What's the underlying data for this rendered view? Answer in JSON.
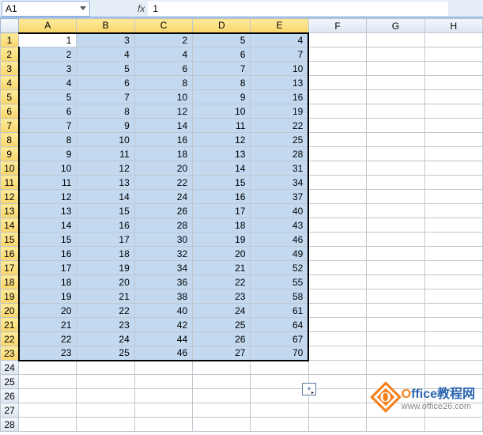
{
  "nameBox": "A1",
  "fxLabel": "fx",
  "formulaValue": "1",
  "colHeaders": [
    "A",
    "B",
    "C",
    "D",
    "E",
    "F",
    "G",
    "H"
  ],
  "selectedColCount": 5,
  "rowCount": 28,
  "selectedRowCount": 23,
  "autofillIcon": "+",
  "grid": [
    [
      1,
      3,
      2,
      5,
      4
    ],
    [
      2,
      4,
      4,
      6,
      7
    ],
    [
      3,
      5,
      6,
      7,
      10
    ],
    [
      4,
      6,
      8,
      8,
      13
    ],
    [
      5,
      7,
      10,
      9,
      16
    ],
    [
      6,
      8,
      12,
      10,
      19
    ],
    [
      7,
      9,
      14,
      11,
      22
    ],
    [
      8,
      10,
      16,
      12,
      25
    ],
    [
      9,
      11,
      18,
      13,
      28
    ],
    [
      10,
      12,
      20,
      14,
      31
    ],
    [
      11,
      13,
      22,
      15,
      34
    ],
    [
      12,
      14,
      24,
      16,
      37
    ],
    [
      13,
      15,
      26,
      17,
      40
    ],
    [
      14,
      16,
      28,
      18,
      43
    ],
    [
      15,
      17,
      30,
      19,
      46
    ],
    [
      16,
      18,
      32,
      20,
      49
    ],
    [
      17,
      19,
      34,
      21,
      52
    ],
    [
      18,
      20,
      36,
      22,
      55
    ],
    [
      19,
      21,
      38,
      23,
      58
    ],
    [
      20,
      22,
      40,
      24,
      61
    ],
    [
      21,
      23,
      42,
      25,
      64
    ],
    [
      22,
      24,
      44,
      26,
      67
    ],
    [
      23,
      25,
      46,
      27,
      70
    ]
  ],
  "chart_data": {
    "type": "table",
    "columns": [
      "A",
      "B",
      "C",
      "D",
      "E"
    ],
    "rows": [
      [
        1,
        3,
        2,
        5,
        4
      ],
      [
        2,
        4,
        4,
        6,
        7
      ],
      [
        3,
        5,
        6,
        7,
        10
      ],
      [
        4,
        6,
        8,
        8,
        13
      ],
      [
        5,
        7,
        10,
        9,
        16
      ],
      [
        6,
        8,
        12,
        10,
        19
      ],
      [
        7,
        9,
        14,
        11,
        22
      ],
      [
        8,
        10,
        16,
        12,
        25
      ],
      [
        9,
        11,
        18,
        13,
        28
      ],
      [
        10,
        12,
        20,
        14,
        31
      ],
      [
        11,
        13,
        22,
        15,
        34
      ],
      [
        12,
        14,
        24,
        16,
        37
      ],
      [
        13,
        15,
        26,
        17,
        40
      ],
      [
        14,
        16,
        28,
        18,
        43
      ],
      [
        15,
        17,
        30,
        19,
        46
      ],
      [
        16,
        18,
        32,
        20,
        49
      ],
      [
        17,
        19,
        34,
        21,
        52
      ],
      [
        18,
        20,
        36,
        22,
        55
      ],
      [
        19,
        21,
        38,
        23,
        58
      ],
      [
        20,
        22,
        40,
        24,
        61
      ],
      [
        21,
        23,
        42,
        25,
        64
      ],
      [
        22,
        24,
        44,
        26,
        67
      ],
      [
        23,
        25,
        46,
        27,
        70
      ]
    ]
  },
  "watermark": {
    "logoLetter": "O",
    "title_prefix": "O",
    "title_rest": "ffice教程网",
    "url": "www.office26.com"
  }
}
